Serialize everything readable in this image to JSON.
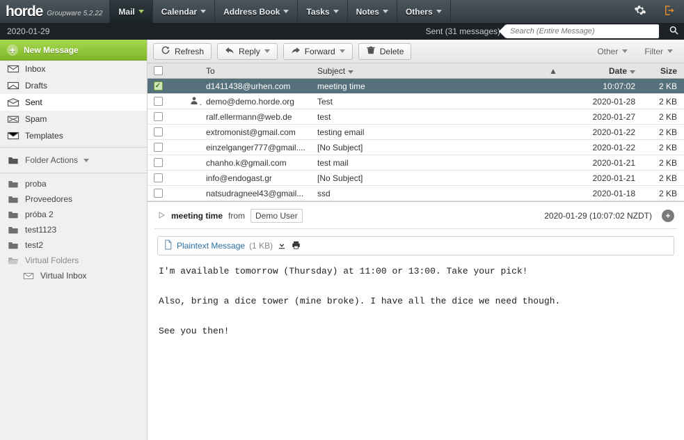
{
  "app": {
    "name": "horde",
    "version_label": "Groupware 5.2.22"
  },
  "topnav": {
    "items": [
      {
        "label": "Mail",
        "active": true
      },
      {
        "label": "Calendar"
      },
      {
        "label": "Address Book"
      },
      {
        "label": "Tasks"
      },
      {
        "label": "Notes"
      },
      {
        "label": "Others"
      }
    ]
  },
  "subbar": {
    "date": "2020-01-29",
    "status": "Sent (31 messages)",
    "search_placeholder": "Search (Entire Message)"
  },
  "sidebar": {
    "new_message": "New Message",
    "mailboxes": [
      {
        "label": "Inbox",
        "icon": "inbox"
      },
      {
        "label": "Drafts",
        "icon": "drafts"
      },
      {
        "label": "Sent",
        "icon": "sent",
        "selected": true
      },
      {
        "label": "Spam",
        "icon": "spam"
      },
      {
        "label": "Templates",
        "icon": "templates"
      }
    ],
    "folder_actions_label": "Folder Actions",
    "folders": [
      {
        "label": "proba"
      },
      {
        "label": "Proveedores"
      },
      {
        "label": "próba 2"
      },
      {
        "label": "test1123"
      },
      {
        "label": "test2"
      }
    ],
    "virtual_label": "Virtual Folders",
    "virtual_children": [
      {
        "label": "Virtual Inbox"
      }
    ]
  },
  "toolbar": {
    "refresh": "Refresh",
    "reply": "Reply",
    "forward": "Forward",
    "delete": "Delete",
    "other": "Other",
    "filter": "Filter"
  },
  "columns": {
    "to": "To",
    "subject": "Subject",
    "date": "Date",
    "size": "Size"
  },
  "messages": [
    {
      "to": "d1411438@urhen.com",
      "subject": "meeting time",
      "date": "10:07:02",
      "size": "2 KB",
      "selected": true,
      "checked": true,
      "person": false
    },
    {
      "to": "demo@demo.horde.org",
      "subject": "Test",
      "date": "2020-01-28",
      "size": "2 KB",
      "person": true
    },
    {
      "to": "ralf.ellermann@web.de",
      "subject": "test",
      "date": "2020-01-27",
      "size": "2 KB"
    },
    {
      "to": "extromonist@gmail.com",
      "subject": "testing email",
      "date": "2020-01-22",
      "size": "2 KB"
    },
    {
      "to": "einzelganger777@gmail....",
      "subject": "[No Subject]",
      "date": "2020-01-22",
      "size": "2 KB"
    },
    {
      "to": "chanho.k@gmail.com",
      "subject": "test mail",
      "date": "2020-01-21",
      "size": "2 KB"
    },
    {
      "to": "info@endogast.gr",
      "subject": "[No Subject]",
      "date": "2020-01-21",
      "size": "2 KB"
    },
    {
      "to": "natsudragneel43@gmail...",
      "subject": "ssd",
      "date": "2020-01-18",
      "size": "2 KB"
    }
  ],
  "preview": {
    "subject": "meeting time",
    "from_label": "from",
    "from_name": "Demo User",
    "timestamp": "2020-01-29 (10:07:02 NZDT)",
    "attachment_label": "Plaintext Message",
    "attachment_size": "(1 KB)",
    "body": "I'm available tomorrow (Thursday) at 11:00 or 13:00. Take your pick!\n\nAlso, bring a dice tower (mine broke). I have all the dice we need though.\n\nSee you then!"
  }
}
